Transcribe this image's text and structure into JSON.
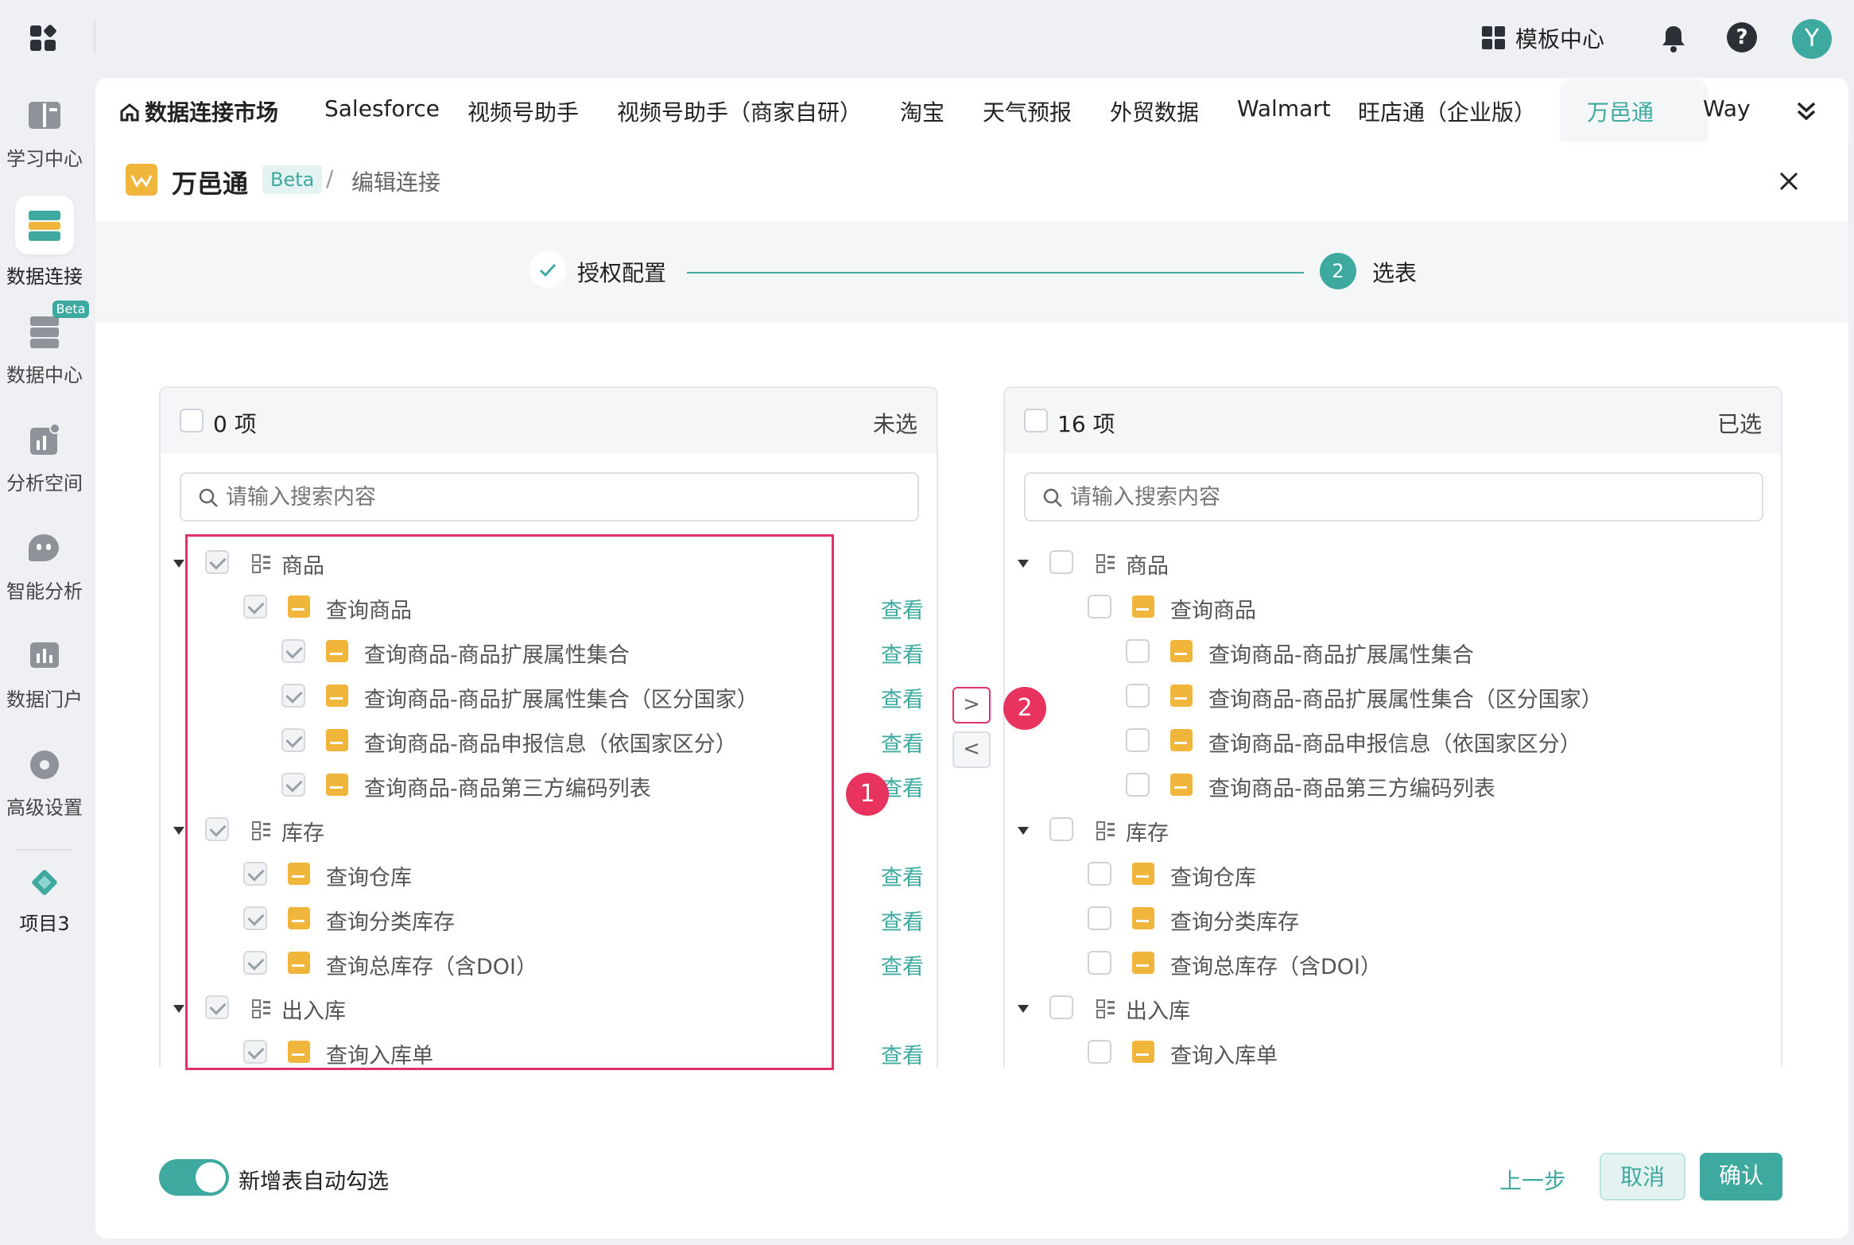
{
  "top": {
    "template_center": "模板中心",
    "avatar": "Y"
  },
  "sidebar": [
    {
      "label": "学习中心",
      "icon": "book-icon"
    },
    {
      "label": "数据连接",
      "icon": "data-connect-icon",
      "active": true
    },
    {
      "label": "数据中心",
      "icon": "database-icon",
      "badge": "Beta"
    },
    {
      "label": "分析空间",
      "icon": "chart-icon"
    },
    {
      "label": "智能分析",
      "icon": "chat-bot-icon"
    },
    {
      "label": "数据门户",
      "icon": "portal-icon"
    },
    {
      "label": "高级设置",
      "icon": "settings-icon"
    },
    {
      "label": "项目3",
      "icon": "project-icon"
    }
  ],
  "tabs": [
    "数据连接市场",
    "Salesforce",
    "视频号助手",
    "视频号助手（商家自研）",
    "淘宝",
    "天气预报",
    "外贸数据",
    "Walmart",
    "旺店通（企业版）",
    "万邑通",
    "Way"
  ],
  "header": {
    "title": "万邑通",
    "beta": "Beta",
    "sep": "/",
    "subtitle": "编辑连接"
  },
  "steps": {
    "step1": "授权配置",
    "step2_num": "2",
    "step2": "选表"
  },
  "left": {
    "count": "0 项",
    "status": "未选",
    "search_placeholder": "请输入搜索内容",
    "view": "查看"
  },
  "right": {
    "count": "16 项",
    "status": "已选",
    "search_placeholder": "请输入搜索内容"
  },
  "tree": [
    {
      "type": "group",
      "label": "商品"
    },
    {
      "type": "item",
      "level": 1,
      "label": "查询商品",
      "view": true
    },
    {
      "type": "item",
      "level": 2,
      "label": "查询商品-商品扩展属性集合",
      "view": true
    },
    {
      "type": "item",
      "level": 2,
      "label": "查询商品-商品扩展属性集合（区分国家）",
      "view": true
    },
    {
      "type": "item",
      "level": 2,
      "label": "查询商品-商品申报信息（依国家区分）",
      "view": true
    },
    {
      "type": "item",
      "level": 2,
      "label": "查询商品-商品第三方编码列表",
      "view": true
    },
    {
      "type": "group",
      "label": "库存"
    },
    {
      "type": "item",
      "level": 1,
      "label": "查询仓库",
      "view": true
    },
    {
      "type": "item",
      "level": 1,
      "label": "查询分类库存",
      "view": true
    },
    {
      "type": "item",
      "level": 1,
      "label": "查询总库存（含DOI）",
      "view": true
    },
    {
      "type": "group",
      "label": "出入库"
    },
    {
      "type": "item",
      "level": 1,
      "label": "查询入库单",
      "view": true
    }
  ],
  "annotations": {
    "badge1": "1",
    "badge2": "2"
  },
  "transfer": {
    "right_arrow": ">",
    "left_arrow": "<"
  },
  "footer": {
    "toggle_label": "新增表自动勾选",
    "prev": "上一步",
    "cancel": "取消",
    "confirm": "确认"
  },
  "colors": {
    "accent": "#3ea99f",
    "annotation": "#e0336b",
    "brand": "#f0b63c"
  }
}
